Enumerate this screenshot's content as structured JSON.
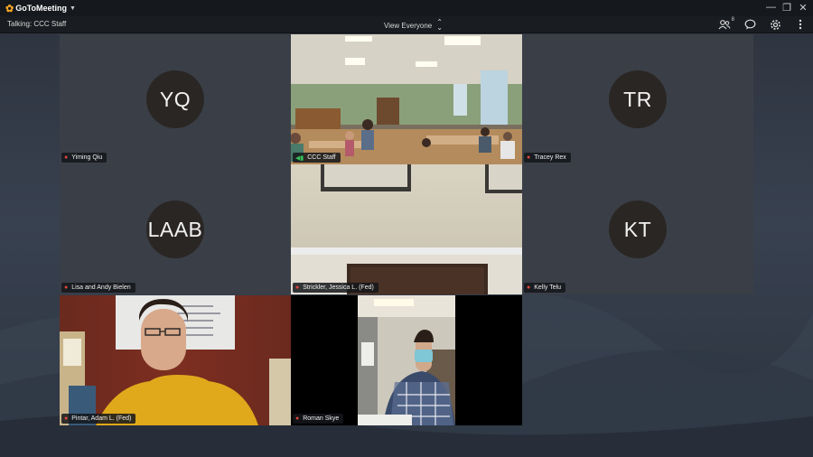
{
  "app": {
    "name": "GoToMeeting"
  },
  "window_controls": {
    "minimize": "—",
    "restore": "❐",
    "close": "✕"
  },
  "toolbar": {
    "talking": "Talking: CCC Staff",
    "view_selector": "View Everyone",
    "attendee_count": "8",
    "icons": [
      "attendees-icon",
      "chat-icon",
      "settings-icon",
      "more-icon"
    ]
  },
  "tiles": [
    {
      "name": "Yiming Qiu",
      "initials": "YQ",
      "video": false,
      "muted": true
    },
    {
      "name": "CCC Staff",
      "video": true,
      "muted": false,
      "speaking": true
    },
    {
      "name": "Tracey Rex",
      "initials": "TR",
      "video": false,
      "muted": true
    },
    {
      "name": "Lisa and Andy Bielen",
      "initials": "LAAB",
      "video": false,
      "muted": true
    },
    {
      "name": "Strickler, Jessica L. (Fed)",
      "video": true,
      "muted": true
    },
    {
      "name": "Kelly Telu",
      "initials": "KT",
      "video": false,
      "muted": true
    },
    {
      "name": "Pintar, Adam L. (Fed)",
      "video": true,
      "muted": true
    },
    {
      "name": "Roman Skye",
      "video": true,
      "muted": true
    }
  ],
  "colors": {
    "accent": "#f5a623",
    "muted_mic": "#e0443e",
    "speaking": "#39c05a"
  }
}
